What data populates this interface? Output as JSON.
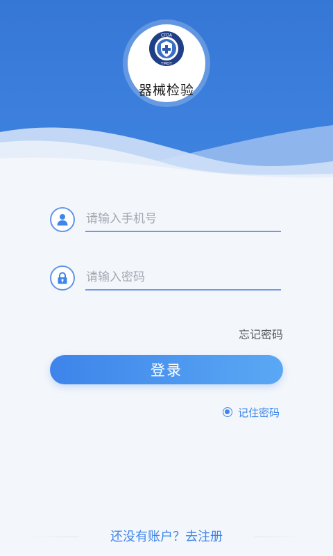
{
  "app": {
    "name": "器械检验",
    "emblem_top_text": "CFDA",
    "emblem_bottom_text": "TMOT"
  },
  "form": {
    "phone_placeholder": "请输入手机号",
    "phone_value": "",
    "password_placeholder": "请输入密码",
    "password_value": "",
    "forgot_password_label": "忘记密码",
    "login_button_label": "登录",
    "remember_password_label": "记住密码",
    "remember_password_checked": true
  },
  "footer": {
    "register_text": "还没有账户？去注册"
  },
  "icons": {
    "phone_field_icon": "user-icon",
    "password_field_icon": "lock-icon"
  },
  "colors": {
    "header_blue": "#3a7ad9",
    "accent_blue": "#3f86ea",
    "background": "#f3f6fb"
  }
}
